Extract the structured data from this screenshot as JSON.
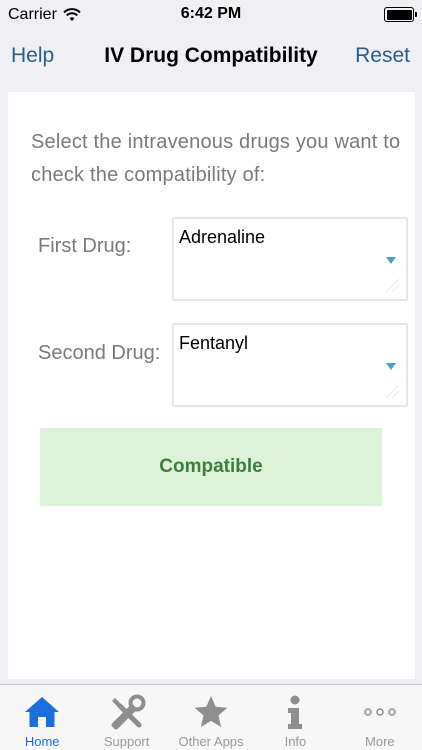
{
  "status_bar": {
    "carrier": "Carrier",
    "time": "6:42 PM"
  },
  "nav": {
    "left": "Help",
    "title": "IV Drug Compatibility",
    "right": "Reset"
  },
  "main": {
    "prompt": "Select the intravenous drugs you want to check the compatibility of:",
    "first_drug": {
      "label": "First Drug:",
      "value": "Adrenaline"
    },
    "second_drug": {
      "label": "Second Drug:",
      "value": "Fentanyl"
    },
    "result": {
      "text": "Compatible",
      "color": "#3f7f3c",
      "background": "#dcf3d8"
    }
  },
  "tabs": [
    {
      "label": "Home",
      "icon": "home-icon",
      "active": true
    },
    {
      "label": "Support",
      "icon": "tools-icon",
      "active": false
    },
    {
      "label": "Other Apps",
      "icon": "star-icon",
      "active": false
    },
    {
      "label": "Info",
      "icon": "info-icon",
      "active": false
    },
    {
      "label": "More",
      "icon": "more-icon",
      "active": false
    }
  ],
  "colors": {
    "accent": "#2b5e8c",
    "tab_active": "#1a6fdc",
    "tab_inactive": "#9a9a9a"
  }
}
